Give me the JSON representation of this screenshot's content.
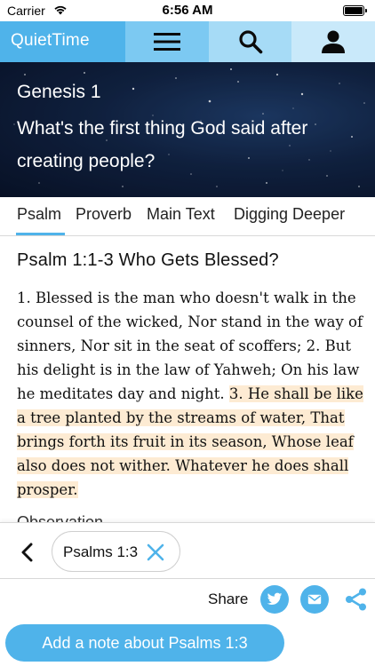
{
  "status_bar": {
    "carrier": "Carrier",
    "time": "6:56 AM"
  },
  "app_bar": {
    "title": "QuietTime",
    "icons": [
      "menu-icon",
      "search-icon",
      "profile-icon"
    ],
    "colors": [
      "#4fb3ea",
      "#7cc9f2",
      "#a6dbf6",
      "#c9e9fa"
    ]
  },
  "hero": {
    "reference": "Genesis 1",
    "question": "What's the first thing God said after creating people?"
  },
  "tabs": [
    {
      "label": "Psalm",
      "selected": true
    },
    {
      "label": "Proverb",
      "selected": false
    },
    {
      "label": "Main Text",
      "selected": false
    },
    {
      "label": "Digging Deeper",
      "selected": false
    }
  ],
  "content": {
    "passage_title": "Psalm 1:1-3 Who Gets Blessed?",
    "passage_plain": "1. Blessed is the man who doesn't walk in the counsel of the wicked, Nor stand in the way of sinners, Nor sit in the seat of scoffers; 2. But his delight is in the law of Yahweh; On his law he meditates day and night.",
    "passage_highlight": "3. He shall be like a tree planted by the streams of water, That brings forth its fruit in its season, Whose leaf also does not wither. Whatever he does shall prosper.",
    "highlight_color": "#fdebd3",
    "next_section_partial": "Observation"
  },
  "verse_bar": {
    "selected_verse": "Psalms 1:3",
    "share_label": "Share",
    "share_icons": [
      "twitter-icon",
      "mail-icon",
      "share-icon"
    ]
  },
  "note_button": {
    "label": "Add a note about Psalms 1:3"
  },
  "accent_color": "#4fb3ea"
}
